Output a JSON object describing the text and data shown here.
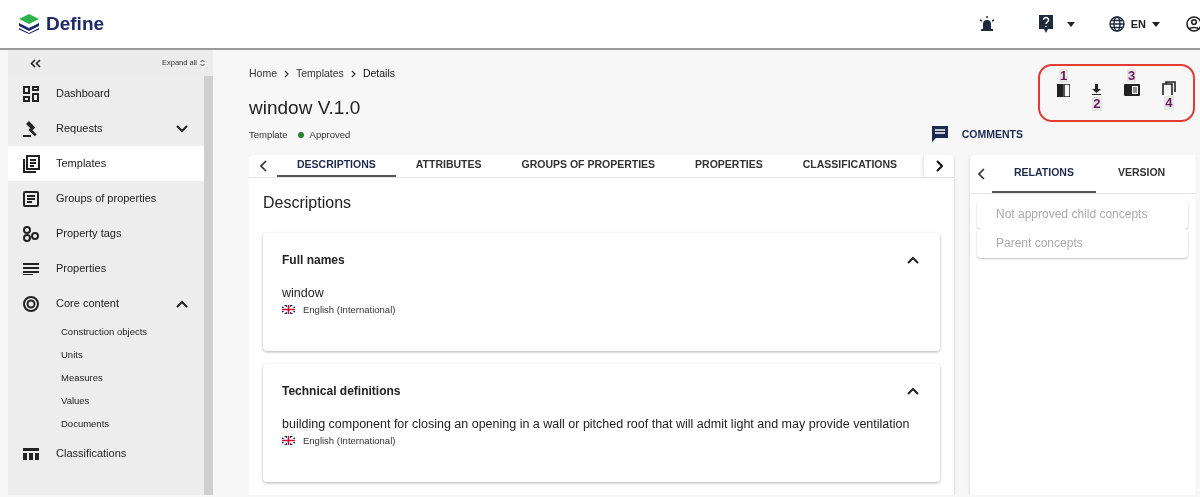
{
  "header": {
    "logo_text": "Define",
    "language": "EN"
  },
  "sidebar": {
    "expand_all": "Expand all",
    "items": [
      {
        "label": "Dashboard",
        "selected": false
      },
      {
        "label": "Requests",
        "selected": false,
        "expanded": false
      },
      {
        "label": "Templates",
        "selected": true
      },
      {
        "label": "Groups of properties",
        "selected": false
      },
      {
        "label": "Property tags",
        "selected": false
      },
      {
        "label": "Properties",
        "selected": false
      },
      {
        "label": "Core content",
        "selected": false,
        "expanded": true,
        "children": [
          {
            "label": "Construction objects",
            "selected": false
          },
          {
            "label": "Units",
            "selected": false
          },
          {
            "label": "Measures",
            "selected": false
          },
          {
            "label": "Values",
            "selected": false
          },
          {
            "label": "Documents",
            "selected": false
          }
        ]
      },
      {
        "label": "Classifications",
        "selected": false
      }
    ]
  },
  "breadcrumb": [
    "Home",
    "Templates",
    "Details"
  ],
  "title": "window V.1.0",
  "subtitle": {
    "type": "Template",
    "status": "Approved"
  },
  "comments_button": "COMMENTS",
  "annotation": {
    "numbers": [
      "1",
      "2",
      "3",
      "4"
    ]
  },
  "tabs": [
    {
      "label": "DESCRIPTIONS",
      "selected": true
    },
    {
      "label": "ATTRIBUTES",
      "selected": false
    },
    {
      "label": "GROUPS OF PROPERTIES",
      "selected": false
    },
    {
      "label": "PROPERTIES",
      "selected": false
    },
    {
      "label": "CLASSIFICATIONS",
      "selected": false
    }
  ],
  "section_title": "Descriptions",
  "panels": [
    {
      "title": "Full names",
      "expanded": true,
      "value": "window",
      "language": "English (International)"
    },
    {
      "title": "Technical definitions",
      "expanded": true,
      "value": "building component for closing an opening in a wall or pitched roof that will admit light and may provide ventilation",
      "language": "English (International)"
    }
  ],
  "side_tabs": [
    {
      "label": "RELATIONS",
      "selected": true
    },
    {
      "label": "VERSION",
      "selected": false
    }
  ],
  "relations": [
    "Not approved child concepts",
    "Parent concepts"
  ]
}
